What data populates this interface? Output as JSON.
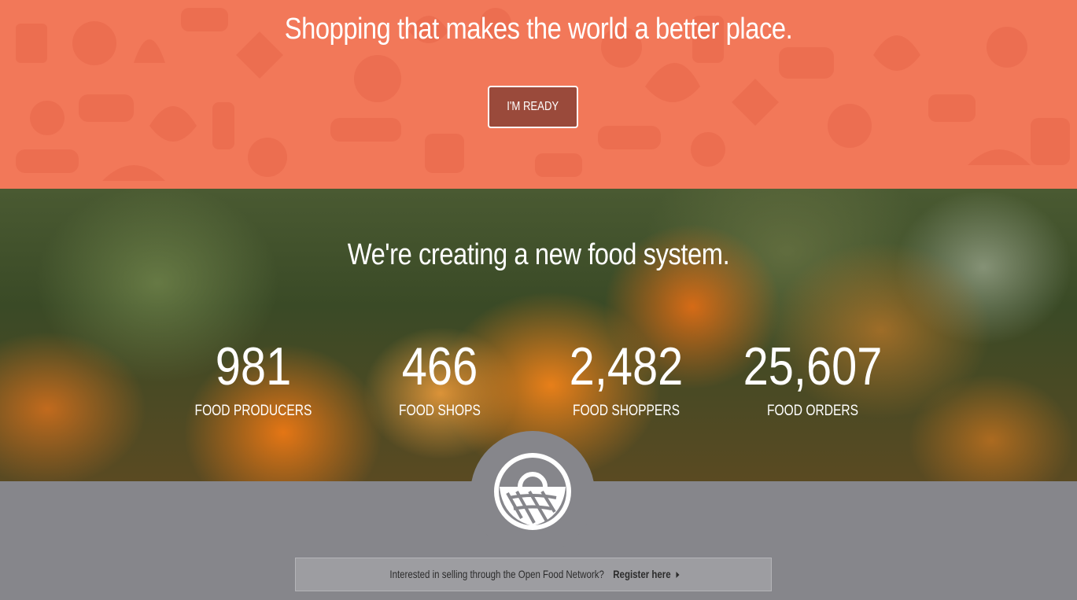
{
  "hero": {
    "title": "Shopping that makes the world a better place.",
    "cta_label": "I'M READY",
    "background_color": "#f27859",
    "button_color": "#9a4a3b"
  },
  "stats": {
    "title": "We're creating a new food system.",
    "items": [
      {
        "number": "981",
        "label": "FOOD PRODUCERS"
      },
      {
        "number": "466",
        "label": "FOOD SHOPS"
      },
      {
        "number": "2,482",
        "label": "FOOD SHOPPERS"
      },
      {
        "number": "25,607",
        "label": "FOOD ORDERS"
      }
    ]
  },
  "logo": {
    "icon": "basket-icon"
  },
  "register": {
    "prompt": "Interested in selling through the Open Food Network?",
    "link_label": "Register here",
    "icon": "caret-right-icon"
  }
}
